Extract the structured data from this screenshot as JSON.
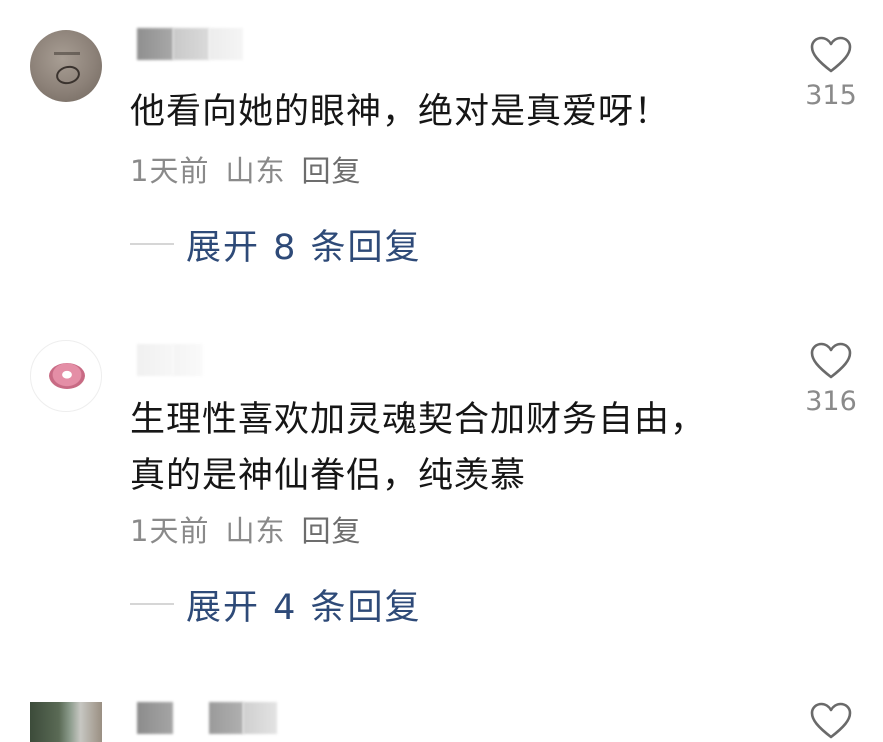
{
  "comments": [
    {
      "text": "他看向她的眼神，绝对是真爱呀！",
      "time": "1天前",
      "location": "山东",
      "reply_label": "回复",
      "expand_label": "展开 8 条回复",
      "likes": "315"
    },
    {
      "text": "生理性喜欢加灵魂契合加财务自由，真的是神仙眷侣，纯羡慕",
      "time": "1天前",
      "location": "山东",
      "reply_label": "回复",
      "expand_label": "展开 4 条回复",
      "likes": "316"
    },
    {
      "text": "",
      "likes": ""
    }
  ],
  "colors": {
    "expand_link": "#2e4a78",
    "meta_text": "#8a8a8a",
    "body_text": "#161616"
  },
  "icons": {
    "like": "heart-outline-icon"
  }
}
